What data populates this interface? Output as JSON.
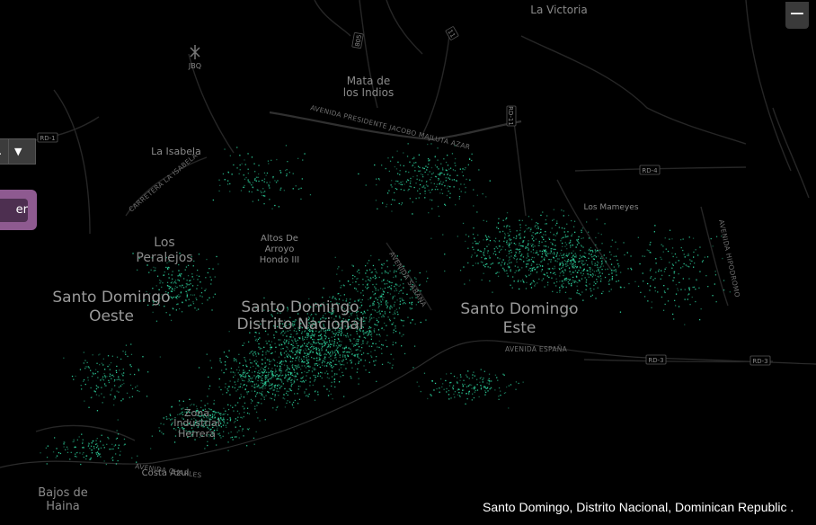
{
  "map": {
    "background_color": "#000000",
    "dot_color": "#2fd6a0",
    "road_color": "#262626",
    "label_color": "#8a8a8a",
    "labels": {
      "la_victoria": "La Victoria",
      "mata_de_los_indios_1": "Mata de",
      "mata_de_los_indios_2": "los Indios",
      "la_isabela": "La Isabela",
      "los_peralejos_1": "Los",
      "los_peralejos_2": "Peralejos",
      "altos_de_arroyo_hondo_1": "Altos De",
      "altos_de_arroyo_hondo_2": "Arroyo",
      "altos_de_arroyo_hondo_3": "Hondo III",
      "sd_oeste_1": "Santo Domingo",
      "sd_oeste_2": "Oeste",
      "sd_dn_1": "Santo Domingo",
      "sd_dn_2": "Distrito Nacional",
      "sd_este_1": "Santo Domingo",
      "sd_este_2": "Este",
      "zona_industrial_1": "Zona",
      "zona_industrial_2": "Industrial",
      "zona_industrial_3": "Herrera",
      "costa_azul": "Costa Azul",
      "bajos_de_haina_1": "Bajos de",
      "bajos_de_haina_2": "Haina",
      "los_mameyes": "Los Mameyes",
      "jbq": "JBQ"
    },
    "road_labels": {
      "av_presidente": "AVENIDA PRESIDENTE JACOBO MAJLUTA AZAR",
      "carretera_isabela": "CARRETERA LA ISABELA",
      "av_espana": "AVENIDA ESPAÑA",
      "av_hipodromo": "AVENIDA HIPODROMO",
      "av_sabana": "AVENIDA SABANA",
      "av_charles": "AVENIDA CHARLES"
    },
    "shields": {
      "rd1": "RD-1",
      "rd4": "RD-4",
      "rd3_a": "RD-3",
      "rd3_b": "RD-3",
      "rd11": "RD-11",
      "r805": "805",
      "r11": "11"
    }
  },
  "controls": {
    "zoom_out_label": "−",
    "select_value": ".",
    "select_caret": "▼",
    "panel_button_label": "er"
  },
  "caption": {
    "location": "Santo Domingo, Distrito Nacional, Dominican Republic  ."
  }
}
